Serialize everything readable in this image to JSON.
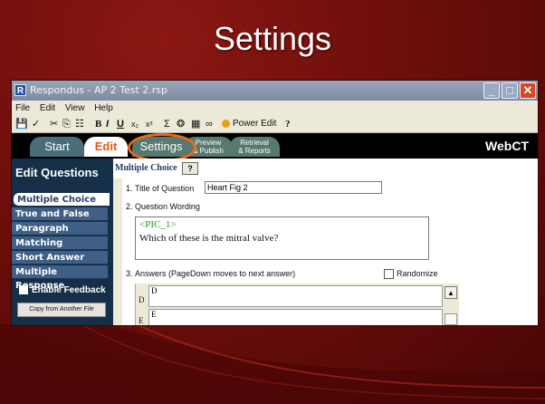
{
  "slide": {
    "title": "Settings"
  },
  "window": {
    "title": "Respondus - AP 2 Test 2.rsp",
    "app_icon": "R",
    "buttons": {
      "minimize": "_",
      "maximize": "□",
      "close": "✕"
    }
  },
  "menu": [
    "File",
    "Edit",
    "View",
    "Help"
  ],
  "toolbar": {
    "power_edit": "Power Edit",
    "help": "?"
  },
  "tabs": {
    "start": "Start",
    "edit": "Edit",
    "settings": "Settings",
    "preview_line1": "Preview",
    "preview_line2": "& Publish",
    "retrieval_line1": "Retrieval",
    "retrieval_line2": "& Reports",
    "platform": "WebCT"
  },
  "sidebar": {
    "header": "Edit Questions",
    "items": [
      {
        "label": "Multiple Choice",
        "active": true
      },
      {
        "label": "True and False"
      },
      {
        "label": "Paragraph"
      },
      {
        "label": "Matching"
      },
      {
        "label": "Short Answer"
      },
      {
        "label": "Multiple Response"
      }
    ],
    "enable_feedback": "Enable Feedback",
    "copy_button": "Copy from Another File"
  },
  "editor": {
    "type_heading": "Multiple Choice",
    "help_button": "?",
    "step1_num": "1.",
    "step1_label": "Title of Question",
    "title_value": "Heart Fig 2",
    "step2_num": "2.",
    "step2_label": "Question Wording",
    "question_line1": "<PIC_1>",
    "question_line2": "Which of these is the mitral valve?",
    "step3_num": "3.",
    "step3_label": "Answers (PageDown moves to next answer)",
    "randomize_label": "Randomize",
    "answers": [
      {
        "key": "D",
        "value": "D"
      },
      {
        "key": "E",
        "value": "E"
      }
    ]
  },
  "colors": {
    "slide_bg": "#6c0e0b",
    "tab_bar": "#000000",
    "sidebar_bg": "#142f47",
    "highlight_ring": "#ef6a1a",
    "edit_tab_text": "#e05a12"
  }
}
